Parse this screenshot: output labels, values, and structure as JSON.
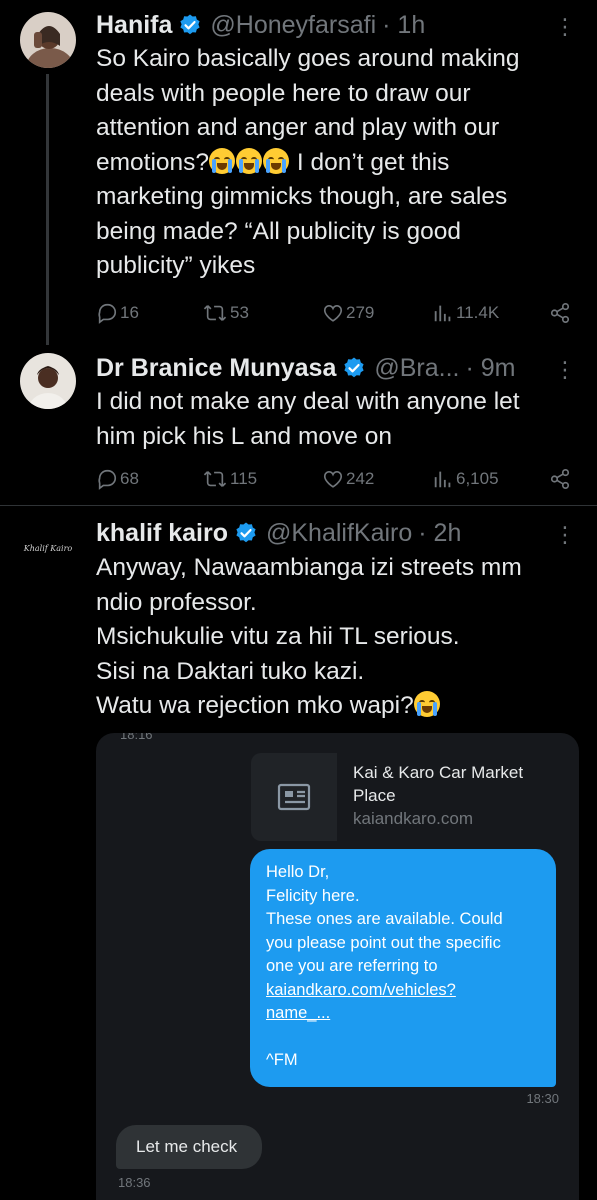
{
  "tweets": [
    {
      "name": "Hanifa",
      "handle": "@Honeyfarsafi",
      "time": "· 1h",
      "text_lines": [
        "So Kairo basically goes around making",
        "deals with people here to draw our",
        "attention and anger and play with our",
        "emotions?",
        "marketing gimmicks though, are sales",
        "being made? “All publicity is good",
        "publicity” yikes"
      ],
      "text_line4_tail": " I don’t get this",
      "replies": "16",
      "reposts": "53",
      "likes": "279",
      "views": "11.4K"
    },
    {
      "name": "Dr Branice Munyasa",
      "handle": "@Bra...",
      "time": "· 9m",
      "text_lines": [
        "I did not make any deal with anyone let",
        "him pick his L and move on"
      ],
      "replies": "68",
      "reposts": "115",
      "likes": "242",
      "views": "6,105"
    },
    {
      "name": "khalif kairo",
      "handle": "@KhalifKairo",
      "time": "· 2h",
      "avatar_text": "Khalif Kairo",
      "text_lines": [
        "Anyway, Nawaambianga izi streets mm",
        "ndio professor.",
        "Msichukulie vitu za hii TL serious.",
        "Sisi na Daktari tuko kazi.",
        "Watu wa rejection mko wapi?"
      ]
    }
  ],
  "chat": {
    "time_top": "18:16",
    "link_title": "Kai & Karo Car Market Place",
    "link_url": "kaiandkaro.com",
    "bubble_out_lines": [
      "Hello Dr,",
      "Felicity here.",
      "These ones are available. Could",
      "you please point out the specific",
      "one you are referring to"
    ],
    "bubble_out_link1": "kaiandkaro.com/vehicles?",
    "bubble_out_link2": "name_...",
    "bubble_out_sign": "^FM",
    "time_out": "18:30",
    "bubble_in": "Let me check",
    "time_in": "18:36"
  },
  "icons": [
    "reply-icon",
    "repost-icon",
    "like-icon",
    "views-icon",
    "share-icon",
    "more-icon",
    "verified-icon",
    "link-card-icon"
  ],
  "colors": {
    "background": "#000000",
    "secondary_text": "#71767b",
    "verified": "#1d9bf0",
    "bubble_out": "#1d9bf0"
  }
}
